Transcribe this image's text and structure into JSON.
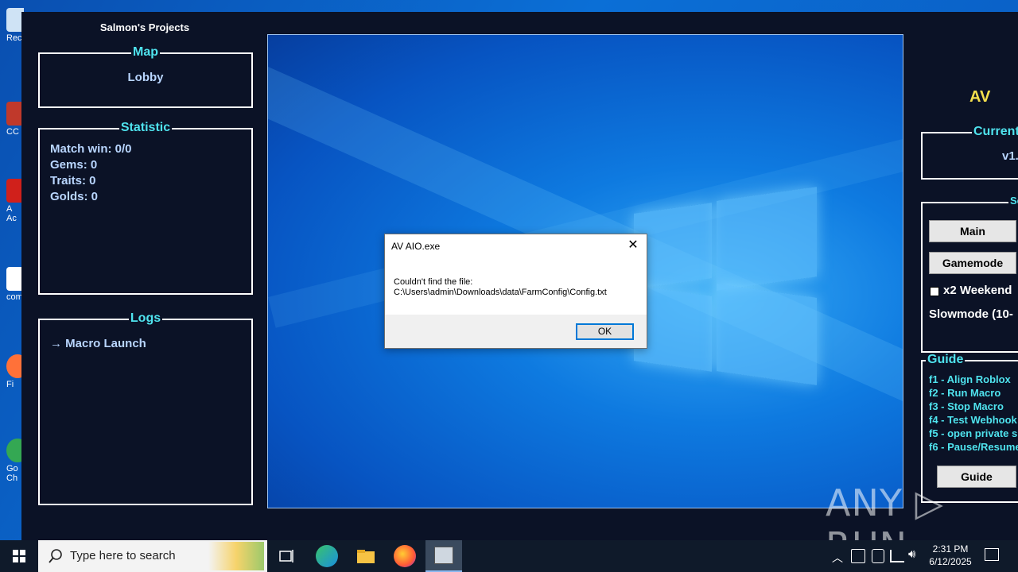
{
  "app": {
    "title": "Salmon's Projects",
    "map": {
      "title": "Map",
      "value": "Lobby"
    },
    "statistic": {
      "title": "Statistic",
      "lines": [
        "Match win: 0/0",
        "Gems: 0",
        "Traits: 0",
        "Golds: 0"
      ]
    },
    "logs": {
      "title": "Logs",
      "lines": [
        "→ Macro Launch"
      ]
    },
    "right": {
      "title": "AV",
      "current": {
        "title": "Current",
        "value": "v1."
      },
      "settings": {
        "title": "Sett",
        "main_button": "Main",
        "gamemode_button": "Gamemode",
        "weekend_label": "x2 Weekend",
        "slowmode_label": "Slowmode (10-"
      },
      "guide": {
        "title": "Guide",
        "lines": [
          "f1  -  Align Roblox",
          "f2  -  Run Macro",
          "f3  -  Stop Macro",
          "f4  -  Test Webhook",
          "f5  -  open private s",
          "f6  -  Pause/Resume"
        ],
        "button": "Guide"
      }
    }
  },
  "dialog": {
    "title": "AV AIO.exe",
    "message_line1": "Couldn't find the file:",
    "message_line2": "C:\\Users\\admin\\Downloads\\data\\FarmConfig\\Config.txt",
    "ok_label": "OK"
  },
  "desktop_icons": [
    {
      "label": "Rec"
    },
    {
      "label": "CC"
    },
    {
      "label": "A"
    },
    {
      "label": "Ac"
    },
    {
      "label": "com"
    },
    {
      "label": "Fi"
    },
    {
      "label": "Go"
    },
    {
      "label": "Ch"
    }
  ],
  "watermark": "ANY ▷ RUN",
  "taskbar": {
    "search_placeholder": "Type here to search",
    "time": "2:31 PM",
    "date": "6/12/2025"
  },
  "colors": {
    "app_bg": "#0b1226",
    "accent_cyan": "#4fe3ee",
    "accent_yellow": "#f4e04d",
    "text_lightblue": "#b9d6ff"
  }
}
